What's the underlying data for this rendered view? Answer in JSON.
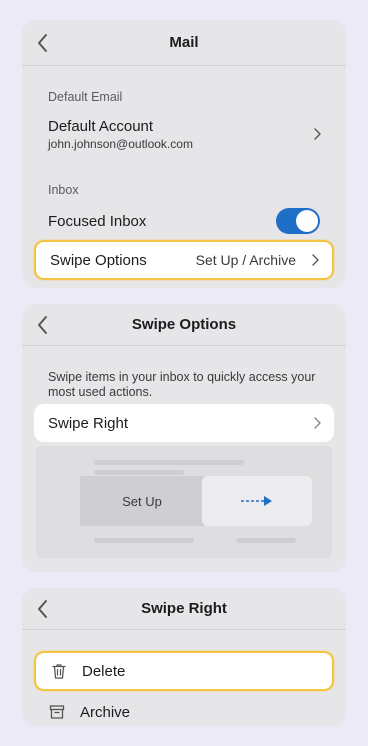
{
  "mail": {
    "title": "Mail",
    "default_email_label": "Default Email",
    "default_account": {
      "title": "Default Account",
      "email": "john.johnson@outlook.com"
    },
    "inbox_label": "Inbox",
    "focused_inbox": {
      "label": "Focused Inbox",
      "enabled": true
    },
    "swipe_options": {
      "label": "Swipe Options",
      "value": "Set Up / Archive"
    }
  },
  "swipe_options_panel": {
    "title": "Swipe Options",
    "description": "Swipe items in your inbox to quickly access your most used actions.",
    "swipe_right": {
      "label": "Swipe Right"
    },
    "preview": {
      "action_label": "Set Up"
    }
  },
  "swipe_right_panel": {
    "title": "Swipe Right",
    "options": [
      {
        "label": "Delete",
        "icon": "trash-icon",
        "selected": true
      },
      {
        "label": "Archive",
        "icon": "archive-icon",
        "selected": false
      }
    ]
  },
  "colors": {
    "highlight": "#f6c443",
    "toggle_on": "#1f6ec8",
    "arrow": "#1f6ec8"
  }
}
